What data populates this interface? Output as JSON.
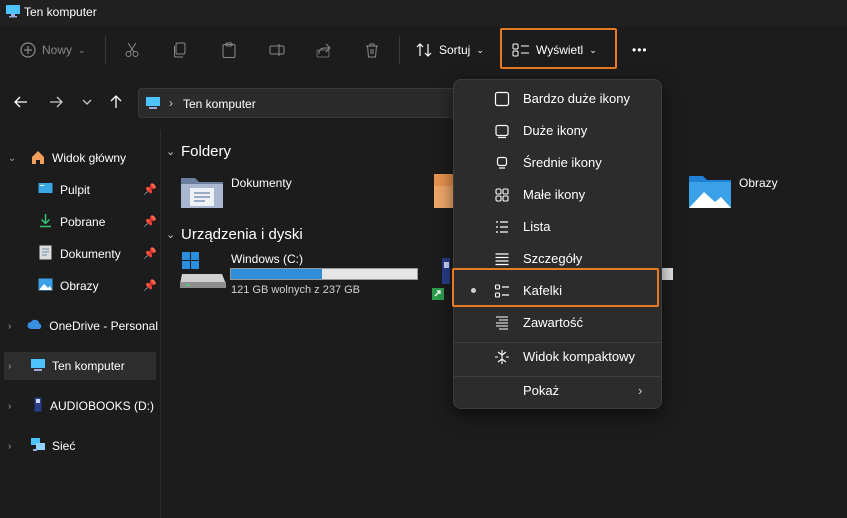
{
  "window": {
    "title": "Ten komputer"
  },
  "toolbar": {
    "new_label": "Nowy",
    "sort_label": "Sortuj",
    "view_label": "Wyświetl",
    "more_label": "•••"
  },
  "nav": {
    "address_path": "Ten komputer"
  },
  "sidebar": {
    "items": [
      {
        "label": "Widok główny"
      },
      {
        "label": "Pulpit"
      },
      {
        "label": "Pobrane"
      },
      {
        "label": "Dokumenty"
      },
      {
        "label": "Obrazy"
      },
      {
        "label": "OneDrive - Personal"
      },
      {
        "label": "Ten komputer"
      },
      {
        "label": "AUDIOBOOKS (D:)"
      },
      {
        "label": "Sieć"
      }
    ]
  },
  "main": {
    "folders_section": "Foldery",
    "folders": [
      {
        "label": "Dokumenty"
      },
      {
        "label": "Obrazy"
      }
    ],
    "drives_section": "Urządzenia i dyski",
    "drives": [
      {
        "label": "Windows (C:)",
        "free_text": "121 GB wolnych z 237 GB",
        "used_fraction": 0.49
      }
    ]
  },
  "view_menu": {
    "items": [
      {
        "label": "Bardzo duże ikony",
        "icon": "extra-large-icons-icon"
      },
      {
        "label": "Duże ikony",
        "icon": "large-icons-icon"
      },
      {
        "label": "Średnie ikony",
        "icon": "medium-icons-icon"
      },
      {
        "label": "Małe ikony",
        "icon": "small-icons-icon"
      },
      {
        "label": "Lista",
        "icon": "list-icon"
      },
      {
        "label": "Szczegóły",
        "icon": "details-icon"
      },
      {
        "label": "Kafelki",
        "icon": "tiles-icon",
        "selected": true
      },
      {
        "label": "Zawartość",
        "icon": "content-icon"
      },
      {
        "label": "Widok kompaktowy",
        "icon": "compact-view-icon"
      },
      {
        "label": "Pokaż",
        "icon": "none"
      }
    ]
  },
  "colors": {
    "accent_highlight": "#e87a22",
    "drive_fill": "#2e8fd8",
    "background": "#1c1c1c",
    "menu_background": "#2c2c2c"
  }
}
